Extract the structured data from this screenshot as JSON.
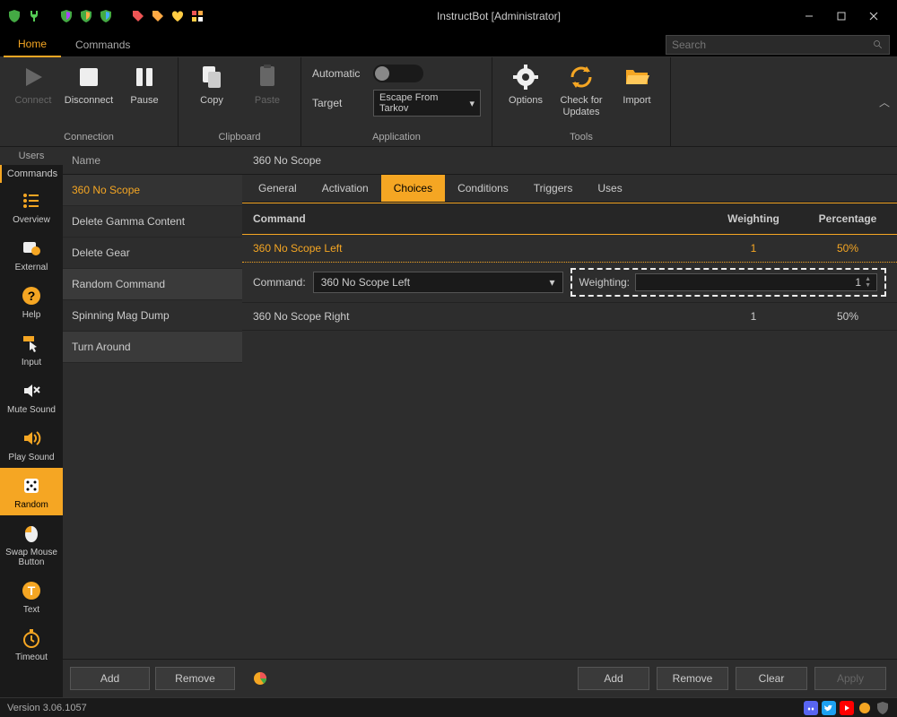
{
  "window": {
    "title": "InstructBot [Administrator]"
  },
  "tabs": {
    "home": "Home",
    "commands": "Commands"
  },
  "search": {
    "placeholder": "Search"
  },
  "ribbon": {
    "connection": {
      "label": "Connection",
      "connect": "Connect",
      "disconnect": "Disconnect",
      "pause": "Pause"
    },
    "clipboard": {
      "label": "Clipboard",
      "copy": "Copy",
      "paste": "Paste"
    },
    "application": {
      "label": "Application",
      "automatic": "Automatic",
      "target": "Target",
      "target_value": "Escape From Tarkov"
    },
    "tools": {
      "label": "Tools",
      "options": "Options",
      "check": "Check for Updates",
      "import": "Import"
    }
  },
  "sidebar": {
    "tabs": {
      "users": "Users",
      "commands": "Commands"
    },
    "items": [
      {
        "label": "Overview"
      },
      {
        "label": "External"
      },
      {
        "label": "Help"
      },
      {
        "label": "Input"
      },
      {
        "label": "Mute Sound"
      },
      {
        "label": "Play Sound"
      },
      {
        "label": "Random"
      },
      {
        "label": "Swap Mouse Button"
      },
      {
        "label": "Text"
      },
      {
        "label": "Timeout"
      }
    ]
  },
  "list": {
    "header": "Name",
    "items": [
      "360 No Scope",
      "Delete Gamma Content",
      "Delete Gear",
      "Random Command",
      "Spinning Mag Dump",
      "Turn Around"
    ],
    "add": "Add",
    "remove": "Remove"
  },
  "main": {
    "title": "360 No Scope",
    "subtabs": {
      "general": "General",
      "activation": "Activation",
      "choices": "Choices",
      "conditions": "Conditions",
      "triggers": "Triggers",
      "uses": "Uses"
    },
    "grid": {
      "headers": {
        "command": "Command",
        "weighting": "Weighting",
        "percentage": "Percentage"
      },
      "rows": [
        {
          "command": "360 No Scope Left",
          "weighting": "1",
          "percentage": "50%"
        },
        {
          "command": "360 No Scope Right",
          "weighting": "1",
          "percentage": "50%"
        }
      ]
    },
    "edit": {
      "command_label": "Command:",
      "command_value": "360 No Scope Left",
      "weighting_label": "Weighting:",
      "weighting_value": "1"
    },
    "actions": {
      "add": "Add",
      "remove": "Remove",
      "clear": "Clear",
      "apply": "Apply"
    }
  },
  "status": {
    "version": "Version 3.06.1057"
  }
}
